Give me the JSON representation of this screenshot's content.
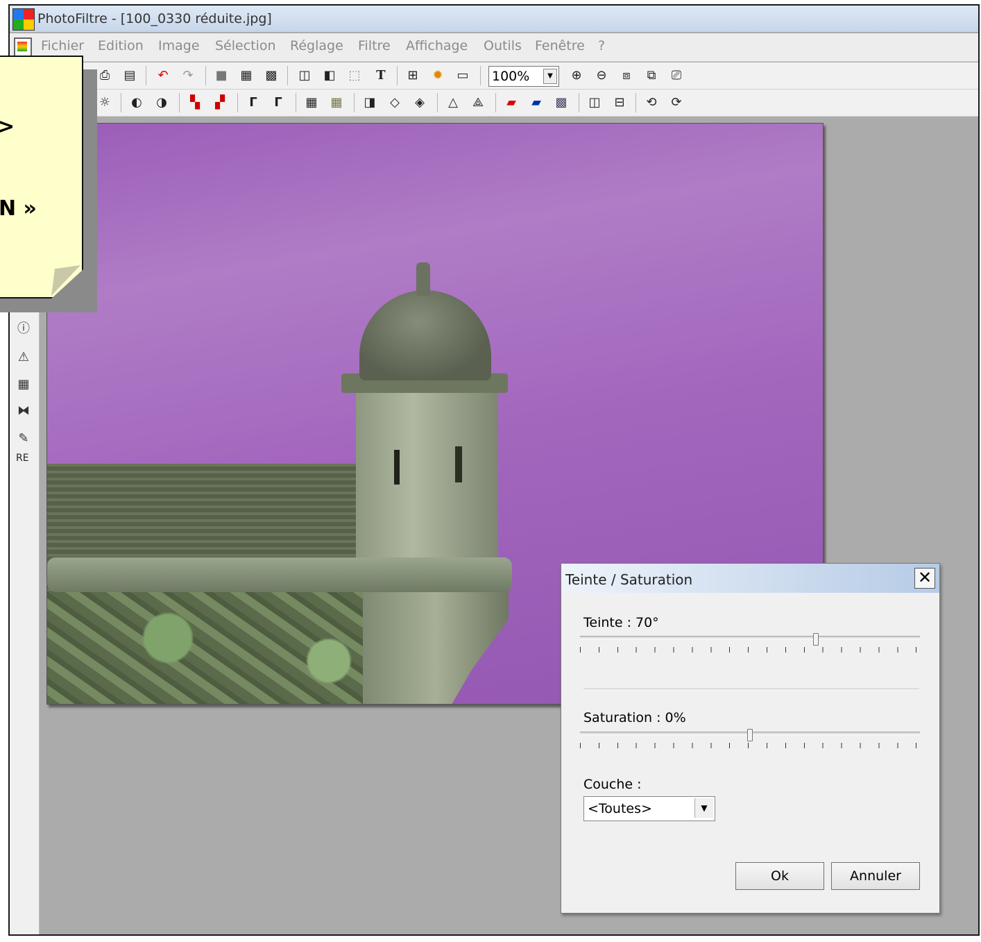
{
  "window": {
    "title": "PhotoFiltre - [100_0330 réduite.jpg]"
  },
  "menu": [
    {
      "label": "Fichier"
    },
    {
      "label": "Edition"
    },
    {
      "label": "Image"
    },
    {
      "label": "Sélection"
    },
    {
      "label": "Réglage"
    },
    {
      "label": "Filtre"
    },
    {
      "label": "Affichage"
    },
    {
      "label": "Outils"
    },
    {
      "label": "Fenêtre"
    },
    {
      "label": "?"
    }
  ],
  "toolbar": {
    "zoom_value": "100%"
  },
  "left_panel": {
    "re_label": "RE"
  },
  "note": {
    "line1": ">",
    "line2": "N »"
  },
  "dialog": {
    "title": "Teinte / Saturation",
    "close_symbol": "✕",
    "hue": {
      "label": "Teinte : 70°",
      "value_deg": 70,
      "range": [
        -180,
        180
      ]
    },
    "saturation": {
      "label": "Saturation : 0%",
      "value_pct": 0,
      "range": [
        -100,
        100
      ]
    },
    "layer": {
      "label": "Couche :",
      "selected": "<Toutes>"
    },
    "ok_label": "Ok",
    "cancel_label": "Annuler"
  },
  "colors": {
    "sky": "#a066bd",
    "note_bg": "#ffffcc",
    "titlebar": "#c6d6ea"
  }
}
